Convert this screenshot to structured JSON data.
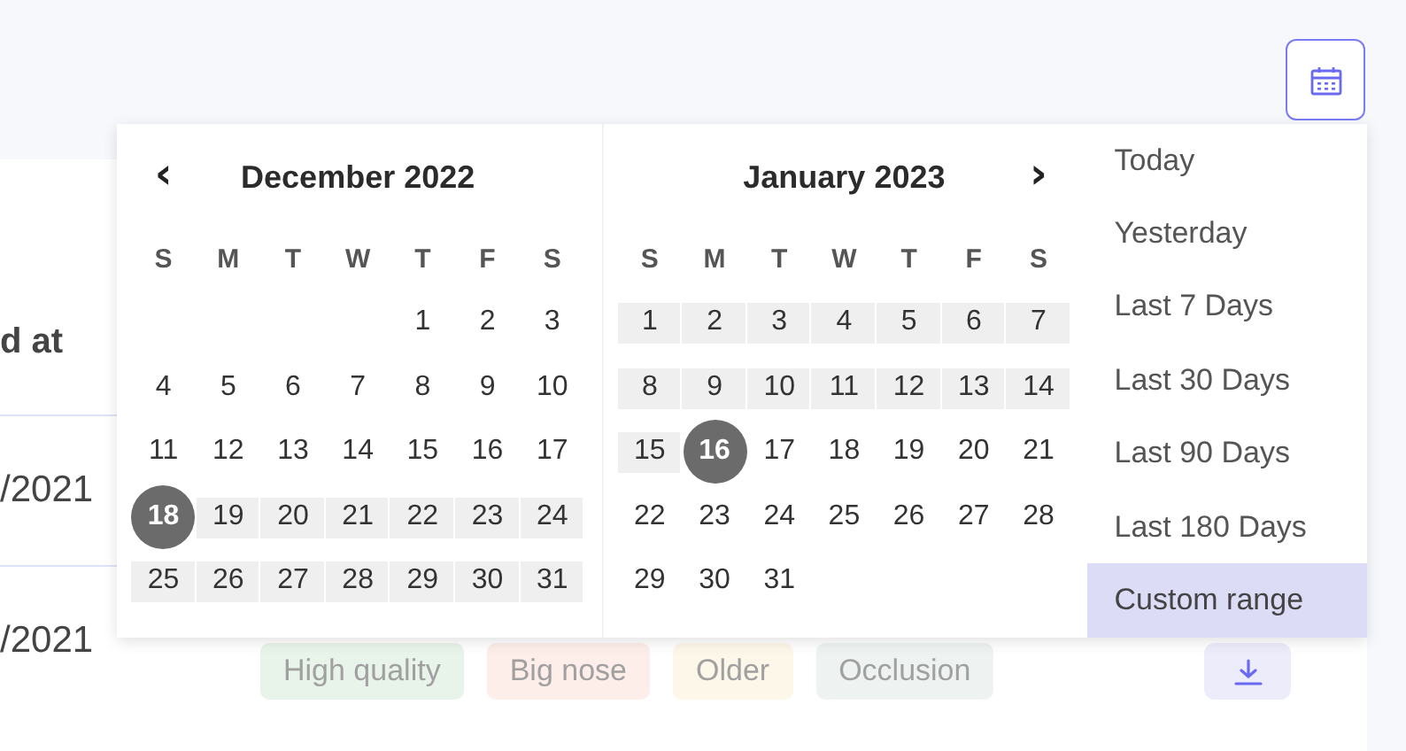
{
  "calendar_button": {
    "active": true
  },
  "table": {
    "header": "d at",
    "rows": [
      {
        "date": "/2021",
        "tags": []
      },
      {
        "date": "/2021",
        "tags": [
          {
            "label": "High quality",
            "color": "#e8f3ea"
          },
          {
            "label": "Big nose",
            "color": "#fdeeea"
          },
          {
            "label": "Older",
            "color": "#fdf7e9"
          },
          {
            "label": "Occlusion",
            "color": "#eef3f1"
          }
        ],
        "actions": [
          {
            "kind": "download"
          }
        ]
      }
    ]
  },
  "date_picker": {
    "calendars": [
      {
        "title": "December 2022",
        "prev_button": "‹",
        "weekdays": [
          "S",
          "M",
          "T",
          "W",
          "T",
          "F",
          "S"
        ],
        "weeks": [
          {
            "days": [
              {
                "kind": "blank"
              },
              {
                "kind": "blank"
              },
              {
                "kind": "blank"
              },
              {
                "kind": "blank"
              },
              {
                "kind": "day",
                "day": "1",
                "in_range": false,
                "selected": false
              },
              {
                "kind": "day",
                "day": "2",
                "in_range": false,
                "selected": false
              },
              {
                "kind": "day",
                "day": "3",
                "in_range": false,
                "selected": false
              }
            ]
          },
          {
            "days": [
              {
                "kind": "day",
                "day": "4",
                "in_range": false,
                "selected": false
              },
              {
                "kind": "day",
                "day": "5",
                "in_range": false,
                "selected": false
              },
              {
                "kind": "day",
                "day": "6",
                "in_range": false,
                "selected": false
              },
              {
                "kind": "day",
                "day": "7",
                "in_range": false,
                "selected": false
              },
              {
                "kind": "day",
                "day": "8",
                "in_range": false,
                "selected": false
              },
              {
                "kind": "day",
                "day": "9",
                "in_range": false,
                "selected": false
              },
              {
                "kind": "day",
                "day": "10",
                "in_range": false,
                "selected": false
              }
            ]
          },
          {
            "days": [
              {
                "kind": "day",
                "day": "11",
                "in_range": false,
                "selected": false
              },
              {
                "kind": "day",
                "day": "12",
                "in_range": false,
                "selected": false
              },
              {
                "kind": "day",
                "day": "13",
                "in_range": false,
                "selected": false
              },
              {
                "kind": "day",
                "day": "14",
                "in_range": false,
                "selected": false
              },
              {
                "kind": "day",
                "day": "15",
                "in_range": false,
                "selected": false
              },
              {
                "kind": "day",
                "day": "16",
                "in_range": false,
                "selected": false
              },
              {
                "kind": "day",
                "day": "17",
                "in_range": false,
                "selected": false
              }
            ]
          },
          {
            "days": [
              {
                "kind": "day",
                "day": "18",
                "in_range": true,
                "selected": true
              },
              {
                "kind": "day",
                "day": "19",
                "in_range": true,
                "selected": false
              },
              {
                "kind": "day",
                "day": "20",
                "in_range": true,
                "selected": false
              },
              {
                "kind": "day",
                "day": "21",
                "in_range": true,
                "selected": false
              },
              {
                "kind": "day",
                "day": "22",
                "in_range": true,
                "selected": false
              },
              {
                "kind": "day",
                "day": "23",
                "in_range": true,
                "selected": false
              },
              {
                "kind": "day",
                "day": "24",
                "in_range": true,
                "selected": false
              }
            ]
          },
          {
            "days": [
              {
                "kind": "day",
                "day": "25",
                "in_range": true,
                "selected": false
              },
              {
                "kind": "day",
                "day": "26",
                "in_range": true,
                "selected": false
              },
              {
                "kind": "day",
                "day": "27",
                "in_range": true,
                "selected": false
              },
              {
                "kind": "day",
                "day": "28",
                "in_range": true,
                "selected": false
              },
              {
                "kind": "day",
                "day": "29",
                "in_range": true,
                "selected": false
              },
              {
                "kind": "day",
                "day": "30",
                "in_range": true,
                "selected": false
              },
              {
                "kind": "day",
                "day": "31",
                "in_range": true,
                "selected": false
              }
            ]
          }
        ]
      },
      {
        "title": "January 2023",
        "next_button": "›",
        "weekdays": [
          "S",
          "M",
          "T",
          "W",
          "T",
          "F",
          "S"
        ],
        "weeks": [
          {
            "days": [
              {
                "kind": "day",
                "day": "1",
                "in_range": true,
                "selected": false
              },
              {
                "kind": "day",
                "day": "2",
                "in_range": true,
                "selected": false
              },
              {
                "kind": "day",
                "day": "3",
                "in_range": true,
                "selected": false
              },
              {
                "kind": "day",
                "day": "4",
                "in_range": true,
                "selected": false
              },
              {
                "kind": "day",
                "day": "5",
                "in_range": true,
                "selected": false
              },
              {
                "kind": "day",
                "day": "6",
                "in_range": true,
                "selected": false
              },
              {
                "kind": "day",
                "day": "7",
                "in_range": true,
                "selected": false
              }
            ]
          },
          {
            "days": [
              {
                "kind": "day",
                "day": "8",
                "in_range": true,
                "selected": false
              },
              {
                "kind": "day",
                "day": "9",
                "in_range": true,
                "selected": false
              },
              {
                "kind": "day",
                "day": "10",
                "in_range": true,
                "selected": false
              },
              {
                "kind": "day",
                "day": "11",
                "in_range": true,
                "selected": false
              },
              {
                "kind": "day",
                "day": "12",
                "in_range": true,
                "selected": false
              },
              {
                "kind": "day",
                "day": "13",
                "in_range": true,
                "selected": false
              },
              {
                "kind": "day",
                "day": "14",
                "in_range": true,
                "selected": false
              }
            ]
          },
          {
            "days": [
              {
                "kind": "day",
                "day": "15",
                "in_range": true,
                "selected": false
              },
              {
                "kind": "day",
                "day": "16",
                "in_range": true,
                "selected": true
              },
              {
                "kind": "day",
                "day": "17",
                "in_range": false,
                "selected": false
              },
              {
                "kind": "day",
                "day": "18",
                "in_range": false,
                "selected": false
              },
              {
                "kind": "day",
                "day": "19",
                "in_range": false,
                "selected": false
              },
              {
                "kind": "day",
                "day": "20",
                "in_range": false,
                "selected": false
              },
              {
                "kind": "day",
                "day": "21",
                "in_range": false,
                "selected": false
              }
            ]
          },
          {
            "days": [
              {
                "kind": "day",
                "day": "22",
                "in_range": false,
                "selected": false
              },
              {
                "kind": "day",
                "day": "23",
                "in_range": false,
                "selected": false
              },
              {
                "kind": "day",
                "day": "24",
                "in_range": false,
                "selected": false
              },
              {
                "kind": "day",
                "day": "25",
                "in_range": false,
                "selected": false
              },
              {
                "kind": "day",
                "day": "26",
                "in_range": false,
                "selected": false
              },
              {
                "kind": "day",
                "day": "27",
                "in_range": false,
                "selected": false
              },
              {
                "kind": "day",
                "day": "28",
                "in_range": false,
                "selected": false
              }
            ]
          },
          {
            "days": [
              {
                "kind": "day",
                "day": "29",
                "in_range": false,
                "selected": false
              },
              {
                "kind": "day",
                "day": "30",
                "in_range": false,
                "selected": false
              },
              {
                "kind": "day",
                "day": "31",
                "in_range": false,
                "selected": false
              }
            ]
          }
        ]
      }
    ],
    "presets": [
      {
        "label": "Today",
        "selected": false
      },
      {
        "label": "Yesterday",
        "selected": false
      },
      {
        "label": "Last 7 Days",
        "selected": false
      },
      {
        "label": "Last 30 Days",
        "selected": false
      },
      {
        "label": "Last 90 Days",
        "selected": false
      },
      {
        "label": "Last 180 Days",
        "selected": false
      },
      {
        "label": "Custom range",
        "selected": true
      }
    ]
  }
}
